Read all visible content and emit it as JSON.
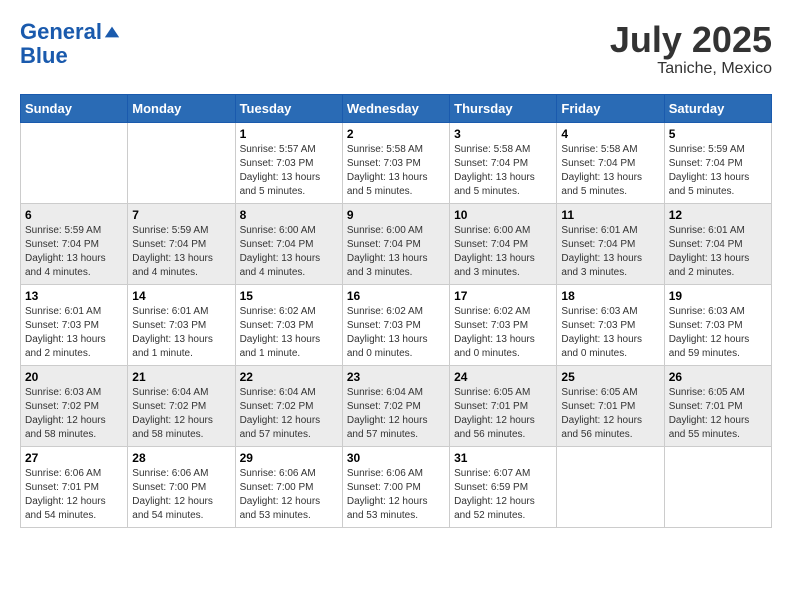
{
  "header": {
    "logo_line1": "General",
    "logo_line2": "Blue",
    "month": "July 2025",
    "location": "Taniche, Mexico"
  },
  "weekdays": [
    "Sunday",
    "Monday",
    "Tuesday",
    "Wednesday",
    "Thursday",
    "Friday",
    "Saturday"
  ],
  "weeks": [
    [
      {
        "day": "",
        "info": ""
      },
      {
        "day": "",
        "info": ""
      },
      {
        "day": "1",
        "info": "Sunrise: 5:57 AM\nSunset: 7:03 PM\nDaylight: 13 hours and 5 minutes."
      },
      {
        "day": "2",
        "info": "Sunrise: 5:58 AM\nSunset: 7:03 PM\nDaylight: 13 hours and 5 minutes."
      },
      {
        "day": "3",
        "info": "Sunrise: 5:58 AM\nSunset: 7:04 PM\nDaylight: 13 hours and 5 minutes."
      },
      {
        "day": "4",
        "info": "Sunrise: 5:58 AM\nSunset: 7:04 PM\nDaylight: 13 hours and 5 minutes."
      },
      {
        "day": "5",
        "info": "Sunrise: 5:59 AM\nSunset: 7:04 PM\nDaylight: 13 hours and 5 minutes."
      }
    ],
    [
      {
        "day": "6",
        "info": "Sunrise: 5:59 AM\nSunset: 7:04 PM\nDaylight: 13 hours and 4 minutes."
      },
      {
        "day": "7",
        "info": "Sunrise: 5:59 AM\nSunset: 7:04 PM\nDaylight: 13 hours and 4 minutes."
      },
      {
        "day": "8",
        "info": "Sunrise: 6:00 AM\nSunset: 7:04 PM\nDaylight: 13 hours and 4 minutes."
      },
      {
        "day": "9",
        "info": "Sunrise: 6:00 AM\nSunset: 7:04 PM\nDaylight: 13 hours and 3 minutes."
      },
      {
        "day": "10",
        "info": "Sunrise: 6:00 AM\nSunset: 7:04 PM\nDaylight: 13 hours and 3 minutes."
      },
      {
        "day": "11",
        "info": "Sunrise: 6:01 AM\nSunset: 7:04 PM\nDaylight: 13 hours and 3 minutes."
      },
      {
        "day": "12",
        "info": "Sunrise: 6:01 AM\nSunset: 7:04 PM\nDaylight: 13 hours and 2 minutes."
      }
    ],
    [
      {
        "day": "13",
        "info": "Sunrise: 6:01 AM\nSunset: 7:03 PM\nDaylight: 13 hours and 2 minutes."
      },
      {
        "day": "14",
        "info": "Sunrise: 6:01 AM\nSunset: 7:03 PM\nDaylight: 13 hours and 1 minute."
      },
      {
        "day": "15",
        "info": "Sunrise: 6:02 AM\nSunset: 7:03 PM\nDaylight: 13 hours and 1 minute."
      },
      {
        "day": "16",
        "info": "Sunrise: 6:02 AM\nSunset: 7:03 PM\nDaylight: 13 hours and 0 minutes."
      },
      {
        "day": "17",
        "info": "Sunrise: 6:02 AM\nSunset: 7:03 PM\nDaylight: 13 hours and 0 minutes."
      },
      {
        "day": "18",
        "info": "Sunrise: 6:03 AM\nSunset: 7:03 PM\nDaylight: 13 hours and 0 minutes."
      },
      {
        "day": "19",
        "info": "Sunrise: 6:03 AM\nSunset: 7:03 PM\nDaylight: 12 hours and 59 minutes."
      }
    ],
    [
      {
        "day": "20",
        "info": "Sunrise: 6:03 AM\nSunset: 7:02 PM\nDaylight: 12 hours and 58 minutes."
      },
      {
        "day": "21",
        "info": "Sunrise: 6:04 AM\nSunset: 7:02 PM\nDaylight: 12 hours and 58 minutes."
      },
      {
        "day": "22",
        "info": "Sunrise: 6:04 AM\nSunset: 7:02 PM\nDaylight: 12 hours and 57 minutes."
      },
      {
        "day": "23",
        "info": "Sunrise: 6:04 AM\nSunset: 7:02 PM\nDaylight: 12 hours and 57 minutes."
      },
      {
        "day": "24",
        "info": "Sunrise: 6:05 AM\nSunset: 7:01 PM\nDaylight: 12 hours and 56 minutes."
      },
      {
        "day": "25",
        "info": "Sunrise: 6:05 AM\nSunset: 7:01 PM\nDaylight: 12 hours and 56 minutes."
      },
      {
        "day": "26",
        "info": "Sunrise: 6:05 AM\nSunset: 7:01 PM\nDaylight: 12 hours and 55 minutes."
      }
    ],
    [
      {
        "day": "27",
        "info": "Sunrise: 6:06 AM\nSunset: 7:01 PM\nDaylight: 12 hours and 54 minutes."
      },
      {
        "day": "28",
        "info": "Sunrise: 6:06 AM\nSunset: 7:00 PM\nDaylight: 12 hours and 54 minutes."
      },
      {
        "day": "29",
        "info": "Sunrise: 6:06 AM\nSunset: 7:00 PM\nDaylight: 12 hours and 53 minutes."
      },
      {
        "day": "30",
        "info": "Sunrise: 6:06 AM\nSunset: 7:00 PM\nDaylight: 12 hours and 53 minutes."
      },
      {
        "day": "31",
        "info": "Sunrise: 6:07 AM\nSunset: 6:59 PM\nDaylight: 12 hours and 52 minutes."
      },
      {
        "day": "",
        "info": ""
      },
      {
        "day": "",
        "info": ""
      }
    ]
  ]
}
